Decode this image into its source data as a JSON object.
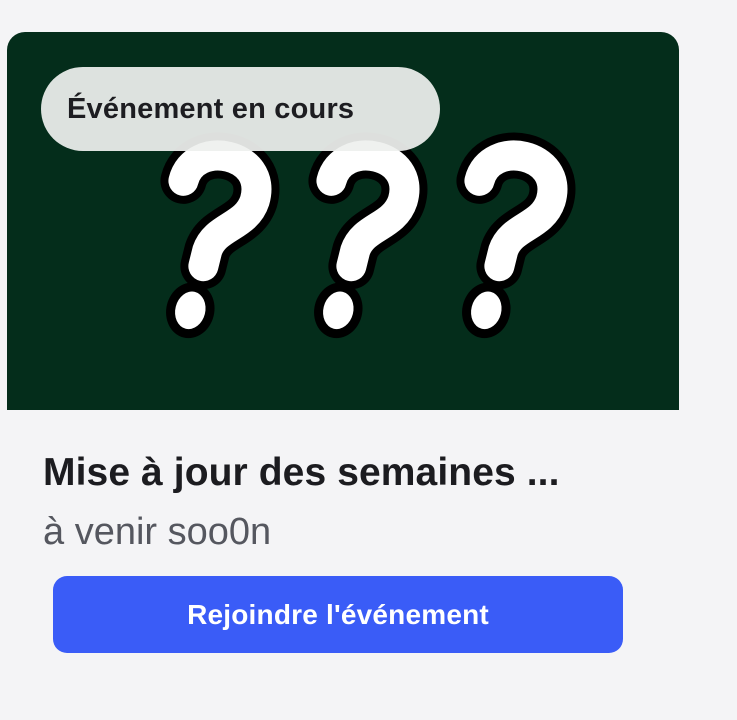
{
  "event_card": {
    "status_badge": "Événement en cours",
    "title": "Mise à jour des semaines ...",
    "subtitle": "à venir soo0n",
    "join_button_label": "Rejoindre l'événement",
    "banner_icon": "question-marks-illustration"
  },
  "colors": {
    "background": "#f4f4f6",
    "banner": "#042d1b",
    "button": "#3a5cf7",
    "button_text": "#ffffff",
    "title_text": "#1c1c20",
    "subtitle_text": "#55575f"
  }
}
